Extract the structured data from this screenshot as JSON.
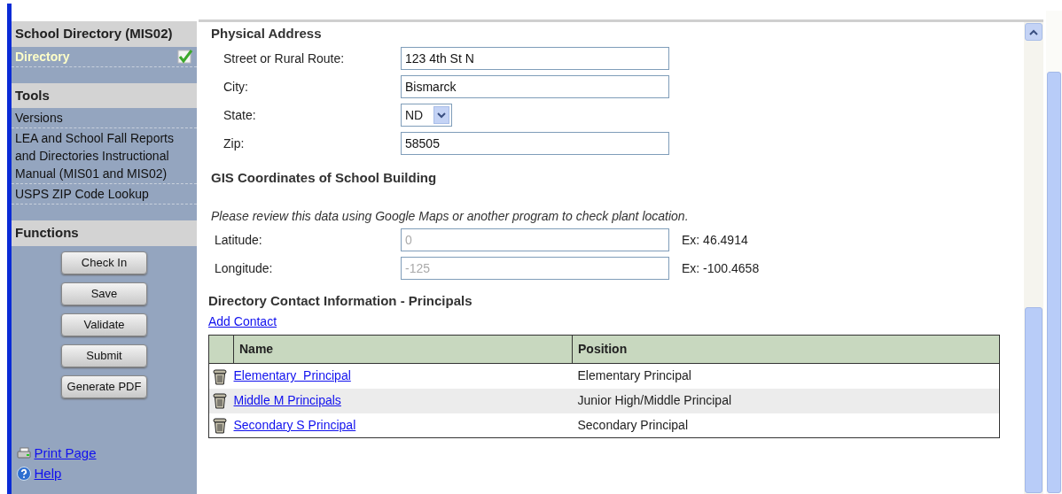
{
  "sidebar": {
    "sections": [
      {
        "title": "School Directory (MIS02)",
        "items": [
          {
            "label": "Directory",
            "selected": true,
            "checked": true
          }
        ]
      },
      {
        "title": "Tools",
        "items": [
          {
            "label": "Versions",
            "selected": false,
            "checked": false
          },
          {
            "label": "LEA and School Fall Reports and Directories Instructional Manual (MIS01 and MIS02)",
            "selected": false,
            "checked": false
          },
          {
            "label": "USPS ZIP Code Lookup",
            "selected": false,
            "checked": false
          }
        ]
      },
      {
        "title": "Functions",
        "buttons": [
          "Check In",
          "Save",
          "Validate",
          "Submit",
          "Generate PDF"
        ]
      }
    ],
    "links": [
      {
        "kind": "print",
        "label": "Print Page"
      },
      {
        "kind": "help",
        "label": "Help"
      }
    ]
  },
  "physical_address": {
    "title": "Physical Address",
    "fields": [
      {
        "kind": "text",
        "label": "Street or Rural Route:",
        "value": "123 4th St N"
      },
      {
        "kind": "text",
        "label": "City:",
        "value": "Bismarck"
      },
      {
        "kind": "select",
        "label": "State:",
        "value": "ND"
      },
      {
        "kind": "text",
        "label": "Zip:",
        "value": "58505"
      }
    ]
  },
  "gis": {
    "title": "GIS Coordinates of School Building",
    "note": "Please review this data using Google Maps or another program to check plant location.",
    "fields": [
      {
        "kind": "text",
        "label": "Latitude:",
        "value": "0",
        "disabled": true,
        "example": "Ex: 46.4914"
      },
      {
        "kind": "text",
        "label": "Longitude:",
        "value": "-125",
        "disabled": true,
        "example": "Ex: -100.4658"
      }
    ]
  },
  "contacts": {
    "title": "Directory Contact Information - Principals",
    "add_link": "Add Contact",
    "columns": [
      "Name",
      "Position"
    ],
    "rows": [
      {
        "name": "Elementary  Principal",
        "position": "Elementary Principal"
      },
      {
        "name": "Middle M Principals",
        "position": "Junior High/Middle Principal"
      },
      {
        "name": "Secondary S Principal",
        "position": "Secondary Principal"
      }
    ]
  }
}
